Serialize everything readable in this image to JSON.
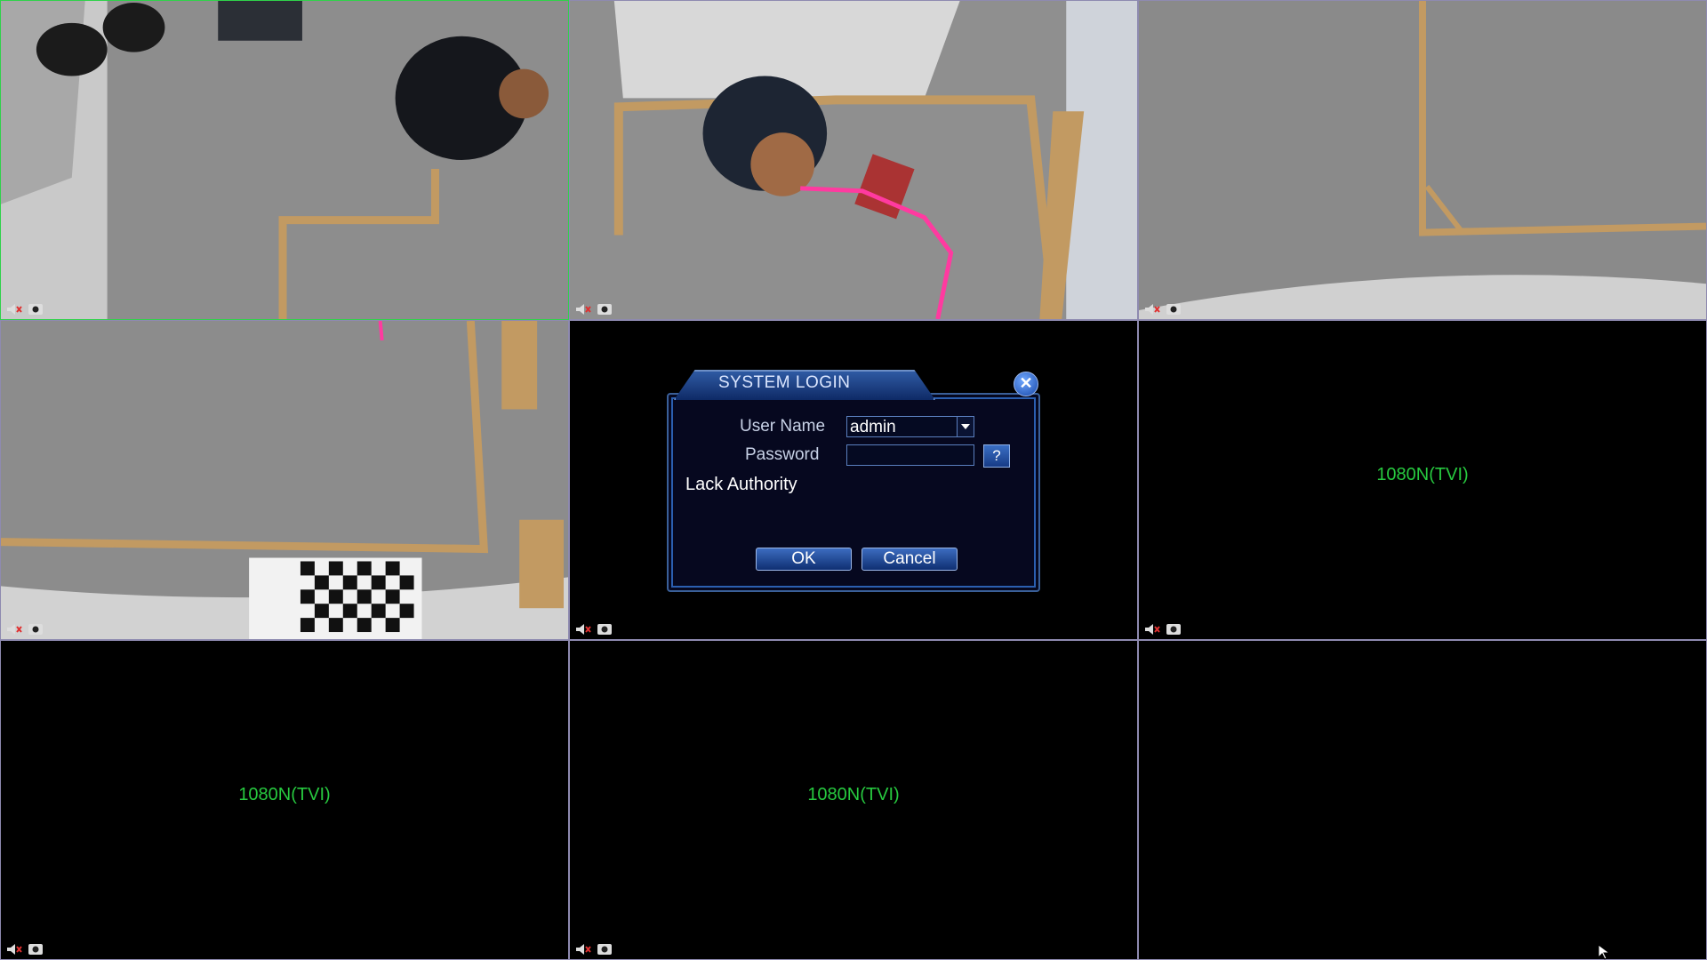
{
  "channel_label": "1080N(TVI)",
  "cells": [
    {
      "id": 1,
      "status": "live",
      "active": true
    },
    {
      "id": 2,
      "status": "live"
    },
    {
      "id": 3,
      "status": "live"
    },
    {
      "id": 4,
      "status": "live"
    },
    {
      "id": 5,
      "status": "no-signal"
    },
    {
      "id": 6,
      "status": "no-signal",
      "label": "1080N(TVI)"
    },
    {
      "id": 7,
      "status": "no-signal",
      "label": "1080N(TVI)"
    },
    {
      "id": 8,
      "status": "no-signal",
      "label": "1080N(TVI)"
    },
    {
      "id": 9,
      "status": "no-signal"
    }
  ],
  "cell_icons": [
    "mute-speaker-icon",
    "snapshot-icon"
  ],
  "dialog": {
    "title": "SYSTEM LOGIN",
    "user_label": "User Name",
    "user_value": "admin",
    "password_label": "Password",
    "password_value": "",
    "help_label": "?",
    "message": "Lack Authority",
    "ok_label": "OK",
    "cancel_label": "Cancel"
  },
  "colors": {
    "channel_text": "#27c93f",
    "active_border": "#2fd24a",
    "grid_border": "#8e8ab0",
    "dialog_bg": "#06081f",
    "dialog_accent": "#2f5aa3"
  }
}
